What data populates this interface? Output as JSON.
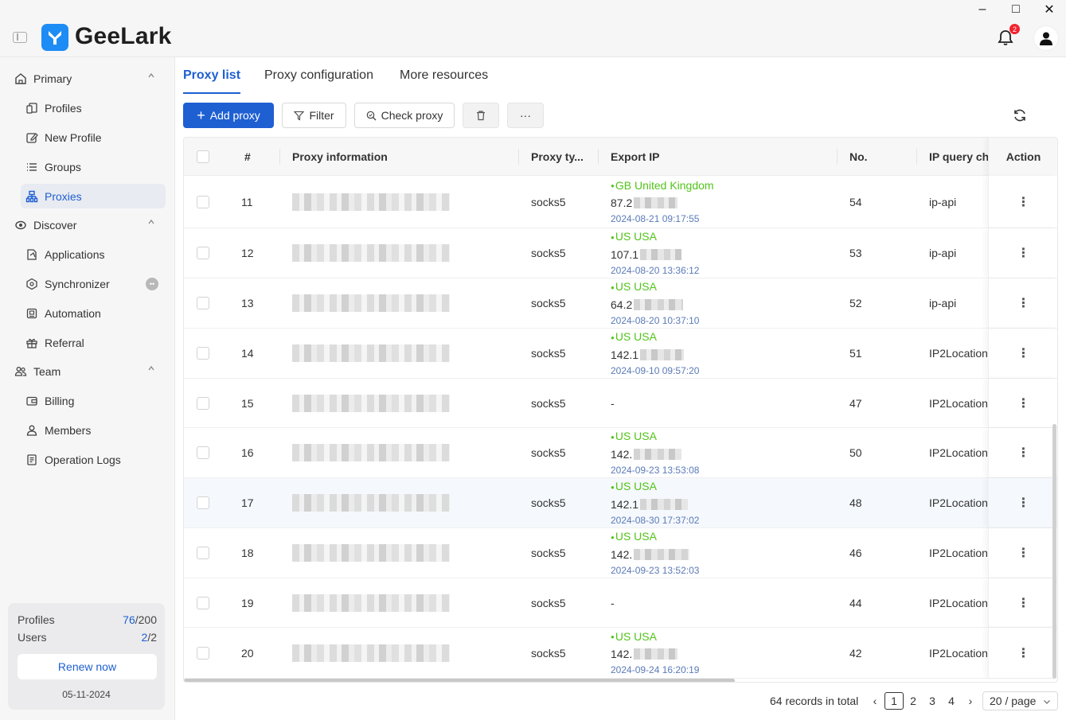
{
  "app": {
    "brand": "GeeLark",
    "notification_count": "2"
  },
  "window_controls": {
    "minimize": "‒",
    "maximize": "□",
    "close": "✕"
  },
  "sidebar": {
    "groups": [
      {
        "label": "Primary",
        "icon": "home-icon"
      },
      {
        "label": "Discover",
        "icon": "discover-icon"
      },
      {
        "label": "Team",
        "icon": "team-icon"
      }
    ],
    "items": [
      {
        "label": "Profiles",
        "icon": "profiles-icon"
      },
      {
        "label": "New Profile",
        "icon": "new-profile-icon"
      },
      {
        "label": "Groups",
        "icon": "groups-icon"
      },
      {
        "label": "Proxies",
        "icon": "proxies-icon",
        "active": true
      },
      {
        "label": "Applications",
        "icon": "applications-icon"
      },
      {
        "label": "Synchronizer",
        "icon": "synchronizer-icon",
        "badge": "••"
      },
      {
        "label": "Automation",
        "icon": "automation-icon"
      },
      {
        "label": "Referral",
        "icon": "referral-icon"
      },
      {
        "label": "Billing",
        "icon": "billing-icon"
      },
      {
        "label": "Members",
        "icon": "members-icon"
      },
      {
        "label": "Operation Logs",
        "icon": "operation-logs-icon"
      }
    ],
    "plan": {
      "profiles_label": "Profiles",
      "profiles_used": "76",
      "profiles_total": "/200",
      "users_label": "Users",
      "users_used": "2",
      "users_total": "/2",
      "renew_label": "Renew now",
      "expiry_date": "05-11-2024"
    }
  },
  "tabs": [
    {
      "label": "Proxy list",
      "active": true
    },
    {
      "label": "Proxy configuration"
    },
    {
      "label": "More resources"
    }
  ],
  "toolbar": {
    "add_label": "Add proxy",
    "filter_label": "Filter",
    "check_label": "Check proxy",
    "more_label": "···"
  },
  "table": {
    "columns": [
      "#",
      "Proxy information",
      "Proxy ty...",
      "Export IP",
      "No.",
      "IP query ch",
      "Action"
    ],
    "rows": [
      {
        "index": "11",
        "type": "socks5",
        "location": "GB United Kingdom",
        "ip": "87.2",
        "time": "2024-08-21 09:17:55",
        "no": "54",
        "query": "ip-api"
      },
      {
        "index": "12",
        "type": "socks5",
        "location": "US USA",
        "ip": "107.1",
        "time": "2024-08-20 13:36:12",
        "no": "53",
        "query": "ip-api"
      },
      {
        "index": "13",
        "type": "socks5",
        "location": "US USA",
        "ip": "64.2",
        "time": "2024-08-20 10:37:10",
        "no": "52",
        "query": "ip-api"
      },
      {
        "index": "14",
        "type": "socks5",
        "location": "US USA",
        "ip": "142.1",
        "time": "2024-09-10 09:57:20",
        "no": "51",
        "query": "IP2Location"
      },
      {
        "index": "15",
        "type": "socks5",
        "location": "",
        "ip": "-",
        "time": "",
        "no": "47",
        "query": "IP2Location"
      },
      {
        "index": "16",
        "type": "socks5",
        "location": "US USA",
        "ip": "142.",
        "time": "2024-09-23 13:53:08",
        "no": "50",
        "query": "IP2Location"
      },
      {
        "index": "17",
        "type": "socks5",
        "location": "US USA",
        "ip": "142.1",
        "time": "2024-08-30 17:37:02",
        "no": "48",
        "query": "IP2Location"
      },
      {
        "index": "18",
        "type": "socks5",
        "location": "US USA",
        "ip": "142.",
        "time": "2024-09-23 13:52:03",
        "no": "46",
        "query": "IP2Location"
      },
      {
        "index": "19",
        "type": "socks5",
        "location": "",
        "ip": "-",
        "time": "",
        "no": "44",
        "query": "IP2Location"
      },
      {
        "index": "20",
        "type": "socks5",
        "location": "US USA",
        "ip": "142.",
        "time": "2024-09-24 16:20:19",
        "no": "42",
        "query": "IP2Location"
      }
    ],
    "action_glyph": "⋮"
  },
  "pagination": {
    "total": "64 records in total",
    "pages": [
      "1",
      "2",
      "3",
      "4"
    ],
    "current": "1",
    "page_size": "20 / page",
    "prev": "‹",
    "next": "›"
  },
  "colors": {
    "accent": "#1e5fd2",
    "location_green": "#52c41a",
    "timestamp": "#5a7ab8"
  }
}
